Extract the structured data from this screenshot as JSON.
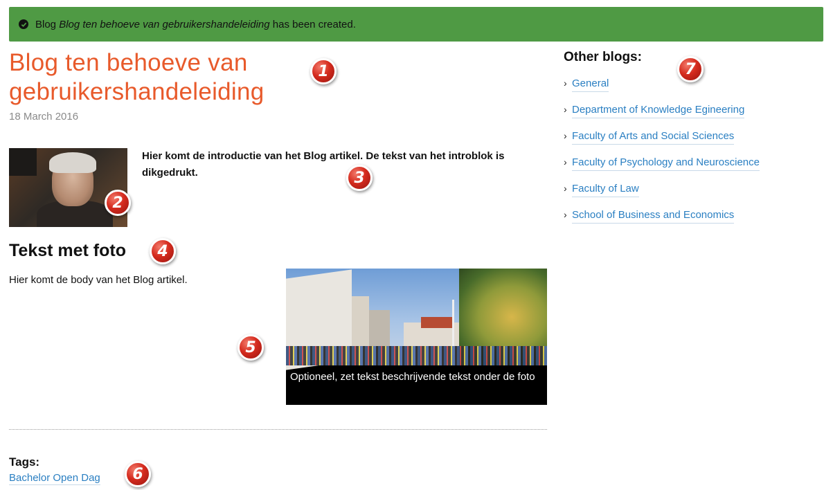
{
  "alert": {
    "prefix": "Blog",
    "blog_name": "Blog ten behoeve van gebruikershandeleiding",
    "suffix": "has been created.",
    "icon": "check-circle-icon",
    "color": "#4f9a44"
  },
  "article": {
    "title": "Blog ten behoeve van gebruikershandeleiding",
    "date": "18 March 2016",
    "intro": "Hier komt de introductie van het Blog artikel. De tekst van het introblok is dikgedrukt.",
    "section_title": "Tekst met foto",
    "body": "Hier komt de body van het Blog artikel.",
    "figure_caption": "Optioneel, zet tekst beschrijvende tekst onder de foto",
    "tags_title": "Tags:",
    "tags": [
      "Bachelor Open Dag"
    ]
  },
  "sidebar": {
    "title": "Other blogs:",
    "items": [
      {
        "label": "General"
      },
      {
        "label": "Department of Knowledge Egineering"
      },
      {
        "label": "Faculty of Arts and Social Sciences"
      },
      {
        "label": "Faculty of Psychology and Neuroscience"
      },
      {
        "label": "Faculty of Law"
      },
      {
        "label": "School of Business and Economics"
      }
    ]
  },
  "markers": [
    "1",
    "2",
    "3",
    "4",
    "5",
    "6",
    "7"
  ],
  "colors": {
    "title": "#e85a2b",
    "link": "#2a7fc2",
    "marker": "#d52b1e"
  }
}
